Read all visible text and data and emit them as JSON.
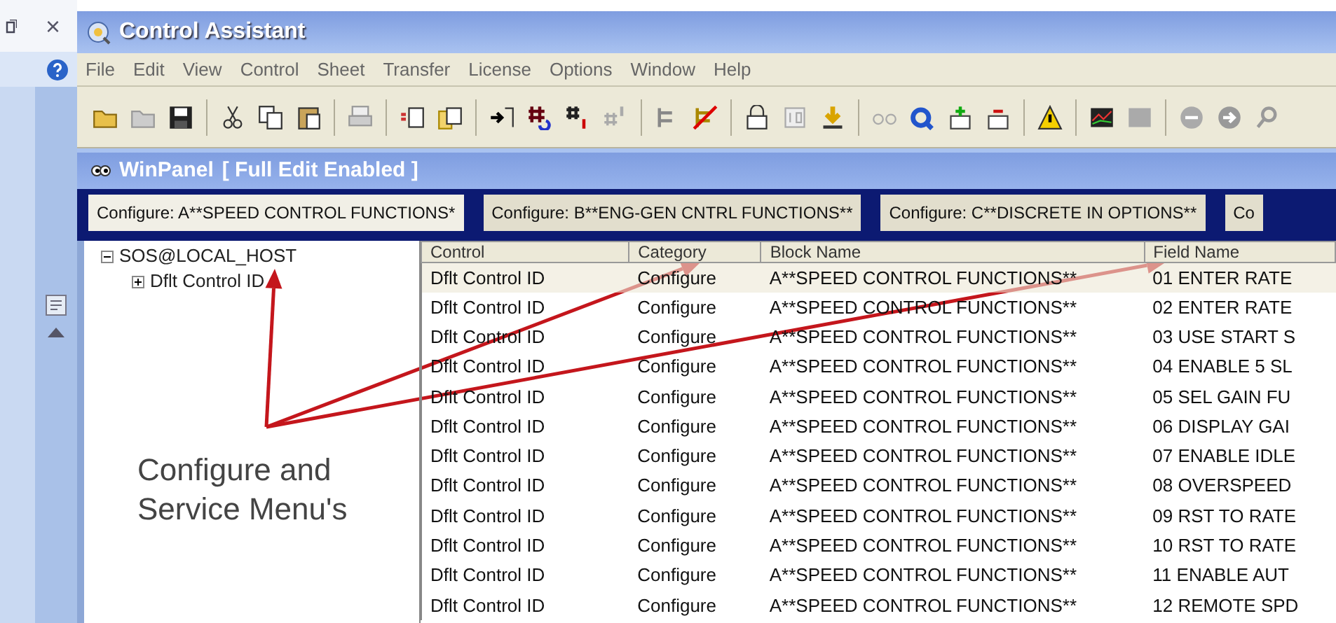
{
  "side_pane": {
    "close": "×"
  },
  "window": {
    "title": "Control Assistant"
  },
  "menu": [
    "File",
    "Edit",
    "View",
    "Control",
    "Sheet",
    "Transfer",
    "License",
    "Options",
    "Window",
    "Help"
  ],
  "panel": {
    "title": "WinPanel",
    "status": "[ Full Edit Enabled ]"
  },
  "tabs": [
    {
      "label": "Configure: A**SPEED CONTROL FUNCTIONS*",
      "selected": true
    },
    {
      "label": "Configure: B**ENG-GEN CNTRL FUNCTIONS**",
      "selected": false
    },
    {
      "label": "Configure: C**DISCRETE IN OPTIONS**",
      "selected": false
    },
    {
      "label": "Co",
      "selected": false
    }
  ],
  "tree": [
    {
      "label": "SOS@LOCAL_HOST",
      "expanded": true,
      "children": [
        {
          "label": "Dflt Control ID",
          "expanded": false
        }
      ]
    }
  ],
  "table": {
    "columns": [
      "Control",
      "Category",
      "Block Name",
      "Field Name"
    ],
    "rows": [
      {
        "cells": [
          "Dflt Control ID",
          "Configure",
          "A**SPEED CONTROL FUNCTIONS**",
          "01 ENTER RATE"
        ],
        "selected": true
      },
      {
        "cells": [
          "Dflt Control ID",
          "Configure",
          "A**SPEED CONTROL FUNCTIONS**",
          "02 ENTER RATE"
        ],
        "selected": false
      },
      {
        "cells": [
          "Dflt Control ID",
          "Configure",
          "A**SPEED CONTROL FUNCTIONS**",
          "03 USE START S"
        ],
        "selected": false
      },
      {
        "cells": [
          "Dflt Control ID",
          "Configure",
          "A**SPEED CONTROL FUNCTIONS**",
          "04 ENABLE 5 SL"
        ],
        "selected": false
      },
      {
        "cells": [
          "Dflt Control ID",
          "Configure",
          "A**SPEED CONTROL FUNCTIONS**",
          "05 SEL GAIN FU"
        ],
        "selected": false
      },
      {
        "cells": [
          "Dflt Control ID",
          "Configure",
          "A**SPEED CONTROL FUNCTIONS**",
          "06 DISPLAY GAI"
        ],
        "selected": false
      },
      {
        "cells": [
          "Dflt Control ID",
          "Configure",
          "A**SPEED CONTROL FUNCTIONS**",
          "07 ENABLE IDLE"
        ],
        "selected": false
      },
      {
        "cells": [
          "Dflt Control ID",
          "Configure",
          "A**SPEED CONTROL FUNCTIONS**",
          "08 OVERSPEED"
        ],
        "selected": false
      },
      {
        "cells": [
          "Dflt Control ID",
          "Configure",
          "A**SPEED CONTROL FUNCTIONS**",
          "09 RST TO RATE"
        ],
        "selected": false
      },
      {
        "cells": [
          "Dflt Control ID",
          "Configure",
          "A**SPEED CONTROL FUNCTIONS**",
          "10 RST TO RATE"
        ],
        "selected": false
      },
      {
        "cells": [
          "Dflt Control ID",
          "Configure",
          "A**SPEED CONTROL FUNCTIONS**",
          "11 ENABLE AUT"
        ],
        "selected": false
      },
      {
        "cells": [
          "Dflt Control ID",
          "Configure",
          "A**SPEED CONTROL FUNCTIONS**",
          "12 REMOTE SPD"
        ],
        "selected": false
      }
    ]
  },
  "annotation": {
    "text": "Configure and Service Menu's"
  }
}
